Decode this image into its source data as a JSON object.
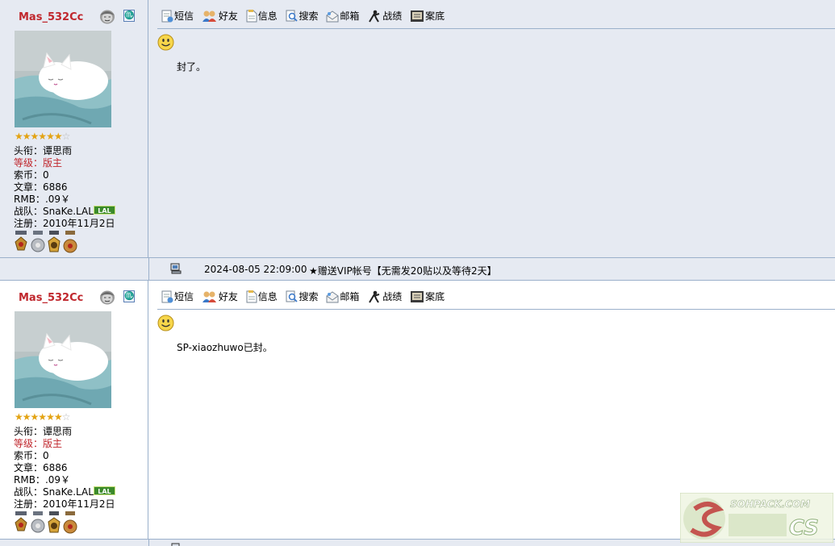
{
  "posts": [
    {
      "username": "Mas_532Cc",
      "zodiac_glyph": "♏",
      "stars_filled": 6,
      "stars_total": 7,
      "profile": {
        "title_label": "头衔：",
        "title_value": "谭思雨",
        "level_label": "等级：",
        "level_value": "版主",
        "coins_label": "索币：",
        "coins_value": "0",
        "posts_label": "文章：",
        "posts_value": "6886",
        "rmb_label": "RMB：",
        "rmb_value": ".09￥",
        "team_label": "战队：",
        "team_value": "SnaKe.LAL",
        "team_badge": "LAL",
        "reg_label": "注册：",
        "reg_value": "2010年11月2日"
      },
      "toolbar": {
        "sms": "短信",
        "friend": "好友",
        "info": "信息",
        "search": "搜索",
        "mail": "邮箱",
        "record": "战绩",
        "archive": "案底"
      },
      "message": "封了。"
    },
    {
      "username": "Mas_532Cc",
      "zodiac_glyph": "♏",
      "stars_filled": 6,
      "stars_total": 7,
      "profile": {
        "title_label": "头衔：",
        "title_value": "谭思雨",
        "level_label": "等级：",
        "level_value": "版主",
        "coins_label": "索币：",
        "coins_value": "0",
        "posts_label": "文章：",
        "posts_value": "6886",
        "rmb_label": "RMB：",
        "rmb_value": ".09￥",
        "team_label": "战队：",
        "team_value": "SnaKe.LAL",
        "team_badge": "LAL",
        "reg_label": "注册：",
        "reg_value": "2010年11月2日"
      },
      "toolbar": {
        "sms": "短信",
        "friend": "好友",
        "info": "信息",
        "search": "搜索",
        "mail": "邮箱",
        "record": "战绩",
        "archive": "案底"
      },
      "message": "SP-xiaozhuwo已封。"
    }
  ],
  "footer": {
    "date": "2024-08-05 22:09:00",
    "note": "★赠送VIP帐号【无需发20贴以及等待2天】"
  },
  "watermark": {
    "url": "SOHPACK.COM",
    "logo_text": "CS"
  },
  "colors": {
    "username": "#c0272d",
    "border": "#9bb0cb",
    "post_bg_alt": "#e6eaf2"
  }
}
